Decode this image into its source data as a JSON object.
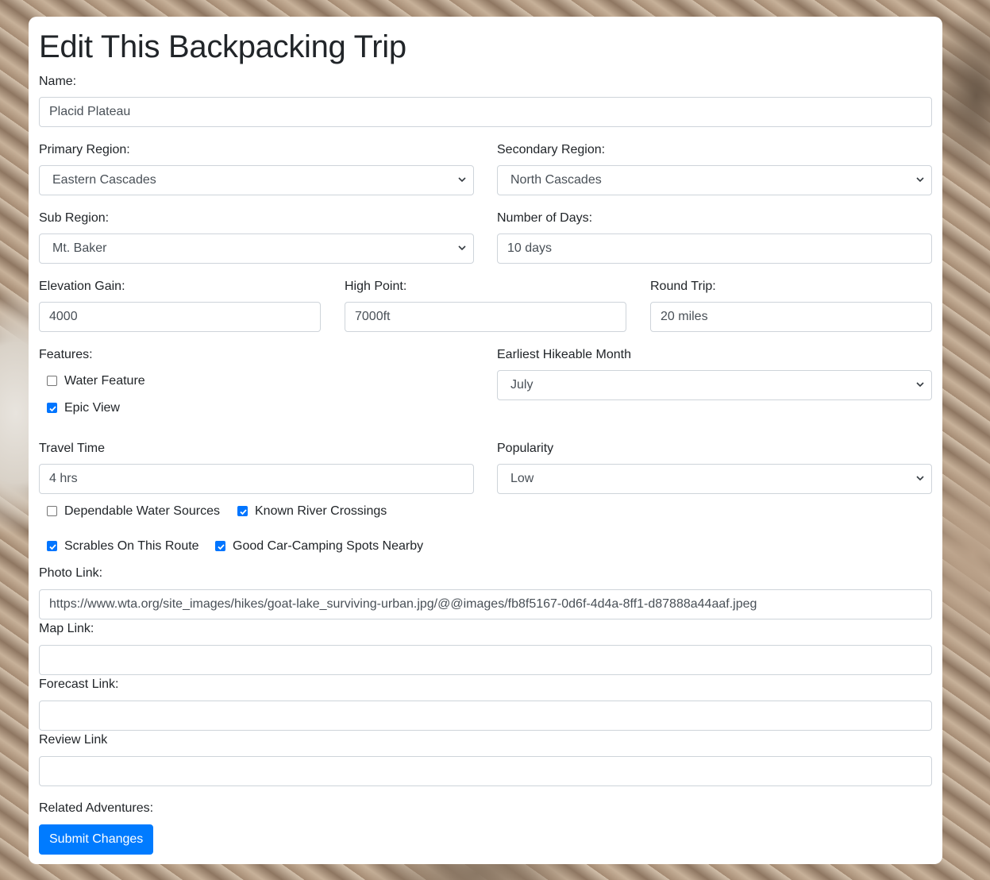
{
  "page": {
    "title": "Edit This Backpacking Trip"
  },
  "form": {
    "name": {
      "label": "Name:",
      "value": "Placid Plateau"
    },
    "primary_region": {
      "label": "Primary Region:",
      "value": "Eastern Cascades"
    },
    "secondary_region": {
      "label": "Secondary Region:",
      "value": "North Cascades"
    },
    "sub_region": {
      "label": "Sub Region:",
      "value": "Mt. Baker"
    },
    "number_of_days": {
      "label": "Number of Days:",
      "value": "10 days"
    },
    "elevation_gain": {
      "label": "Elevation Gain:",
      "value": "4000"
    },
    "high_point": {
      "label": "High Point:",
      "value": "7000ft"
    },
    "round_trip": {
      "label": "Round Trip:",
      "value": "20 miles"
    },
    "features": {
      "label": "Features:",
      "water_feature": {
        "label": "Water Feature",
        "checked": false
      },
      "epic_view": {
        "label": "Epic View",
        "checked": true
      }
    },
    "earliest_month": {
      "label": "Earliest Hikeable Month",
      "value": "July"
    },
    "travel_time": {
      "label": "Travel Time",
      "value": "4 hrs"
    },
    "popularity": {
      "label": "Popularity",
      "value": "Low"
    },
    "options": {
      "dependable_water": {
        "label": "Dependable Water Sources",
        "checked": false
      },
      "river_crossings": {
        "label": "Known River Crossings",
        "checked": true
      },
      "scrambles": {
        "label": "Scrables On This Route",
        "checked": true
      },
      "car_camping": {
        "label": "Good Car-Camping Spots Nearby",
        "checked": true
      }
    },
    "photo_link": {
      "label": "Photo Link:",
      "value": "https://www.wta.org/site_images/hikes/goat-lake_surviving-urban.jpg/@@images/fb8f5167-0d6f-4d4a-8ff1-d87888a44aaf.jpeg"
    },
    "map_link": {
      "label": "Map Link:",
      "value": ""
    },
    "forecast_link": {
      "label": "Forecast Link:",
      "value": ""
    },
    "review_link": {
      "label": "Review Link",
      "value": ""
    },
    "related_adventures": {
      "label": "Related Adventures:"
    },
    "submit_label": "Submit Changes"
  },
  "colors": {
    "accent": "#007bff",
    "checkbox": "#0075ff",
    "border": "#ced4da"
  },
  "icons": {
    "select": "chevron-down-icon",
    "checkbox": "checkmark-icon"
  }
}
